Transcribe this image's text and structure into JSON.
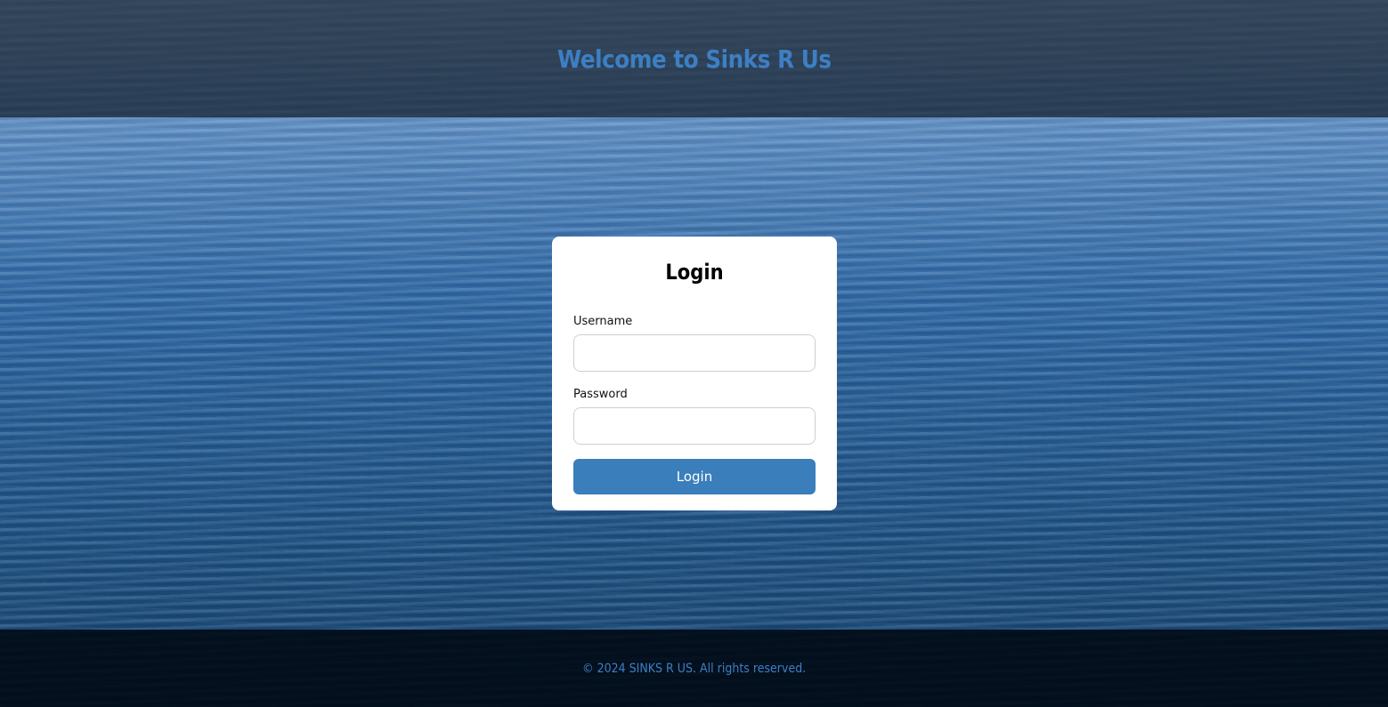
{
  "header": {
    "title": "Welcome to Sinks R Us"
  },
  "login_card": {
    "title": "Login",
    "username_label": "Username",
    "username_value": "",
    "password_label": "Password",
    "password_value": "",
    "submit_label": "Login"
  },
  "footer": {
    "text": "© 2024 SINKS R US. All rights reserved."
  },
  "colors": {
    "accent": "#3a7ebb",
    "header_text": "#3d7fc4",
    "card_background": "#ffffff"
  }
}
